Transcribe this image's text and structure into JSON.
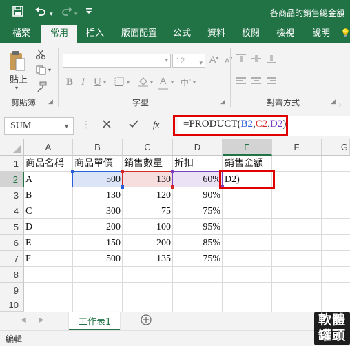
{
  "title_bar": {
    "save_icon": "save-icon",
    "undo_icon": "undo-icon",
    "redo_icon": "redo-icon",
    "customize_icon": "customize-toolbar-icon",
    "document_title": "各商品的銷售總金額"
  },
  "tabs": [
    "檔案",
    "常用",
    "插入",
    "版面配置",
    "公式",
    "資料",
    "校閱",
    "檢視",
    "說明"
  ],
  "active_tab": "常用",
  "ribbon": {
    "clipboard": {
      "paste_label": "貼上",
      "group_label": "剪貼簿"
    },
    "font": {
      "font_size": "12",
      "group_label": "字型"
    },
    "alignment": {
      "group_label": "對齊方式"
    }
  },
  "formula_bar": {
    "name_box": "SUM",
    "cancel_icon": "cancel-icon",
    "enter_icon": "check-icon",
    "fx_label": "fx",
    "formula_parts": [
      {
        "text": "=PRODUCT(",
        "color": "#222222"
      },
      {
        "text": "B2",
        "color": "#2b5fd9"
      },
      {
        "text": ",",
        "color": "#222222"
      },
      {
        "text": "C2",
        "color": "#d72828"
      },
      {
        "text": ",",
        "color": "#222222"
      },
      {
        "text": "D2",
        "color": "#7a3fc0"
      },
      {
        "text": ")",
        "color": "#222222"
      }
    ]
  },
  "columns": [
    "A",
    "B",
    "C",
    "D",
    "E",
    "F",
    "G"
  ],
  "rows": [
    "1",
    "2",
    "3",
    "4",
    "5",
    "6",
    "7",
    "8",
    "9",
    "10"
  ],
  "table": {
    "headers": [
      "商品名稱",
      "商品單價",
      "銷售數量",
      "折扣",
      "銷售金額"
    ],
    "data": [
      [
        "A",
        "500",
        "130",
        "60%",
        "D2)"
      ],
      [
        "B",
        "130",
        "120",
        "90%",
        ""
      ],
      [
        "C",
        "300",
        "75",
        "75%",
        ""
      ],
      [
        "D",
        "200",
        "100",
        "95%",
        ""
      ],
      [
        "E",
        "150",
        "200",
        "85%",
        ""
      ],
      [
        "F",
        "500",
        "135",
        "75%",
        ""
      ]
    ]
  },
  "sheet_tab": "工作表1",
  "add_sheet_icon": "add-sheet-icon",
  "status": "編輯",
  "watermark": "軟體罐頭",
  "colors": {
    "excel_green": "#217346",
    "highlight_red": "#e00000",
    "ref_blue": "#2b5fd9",
    "ref_red": "#d72828",
    "ref_purple": "#7a3fc0"
  }
}
